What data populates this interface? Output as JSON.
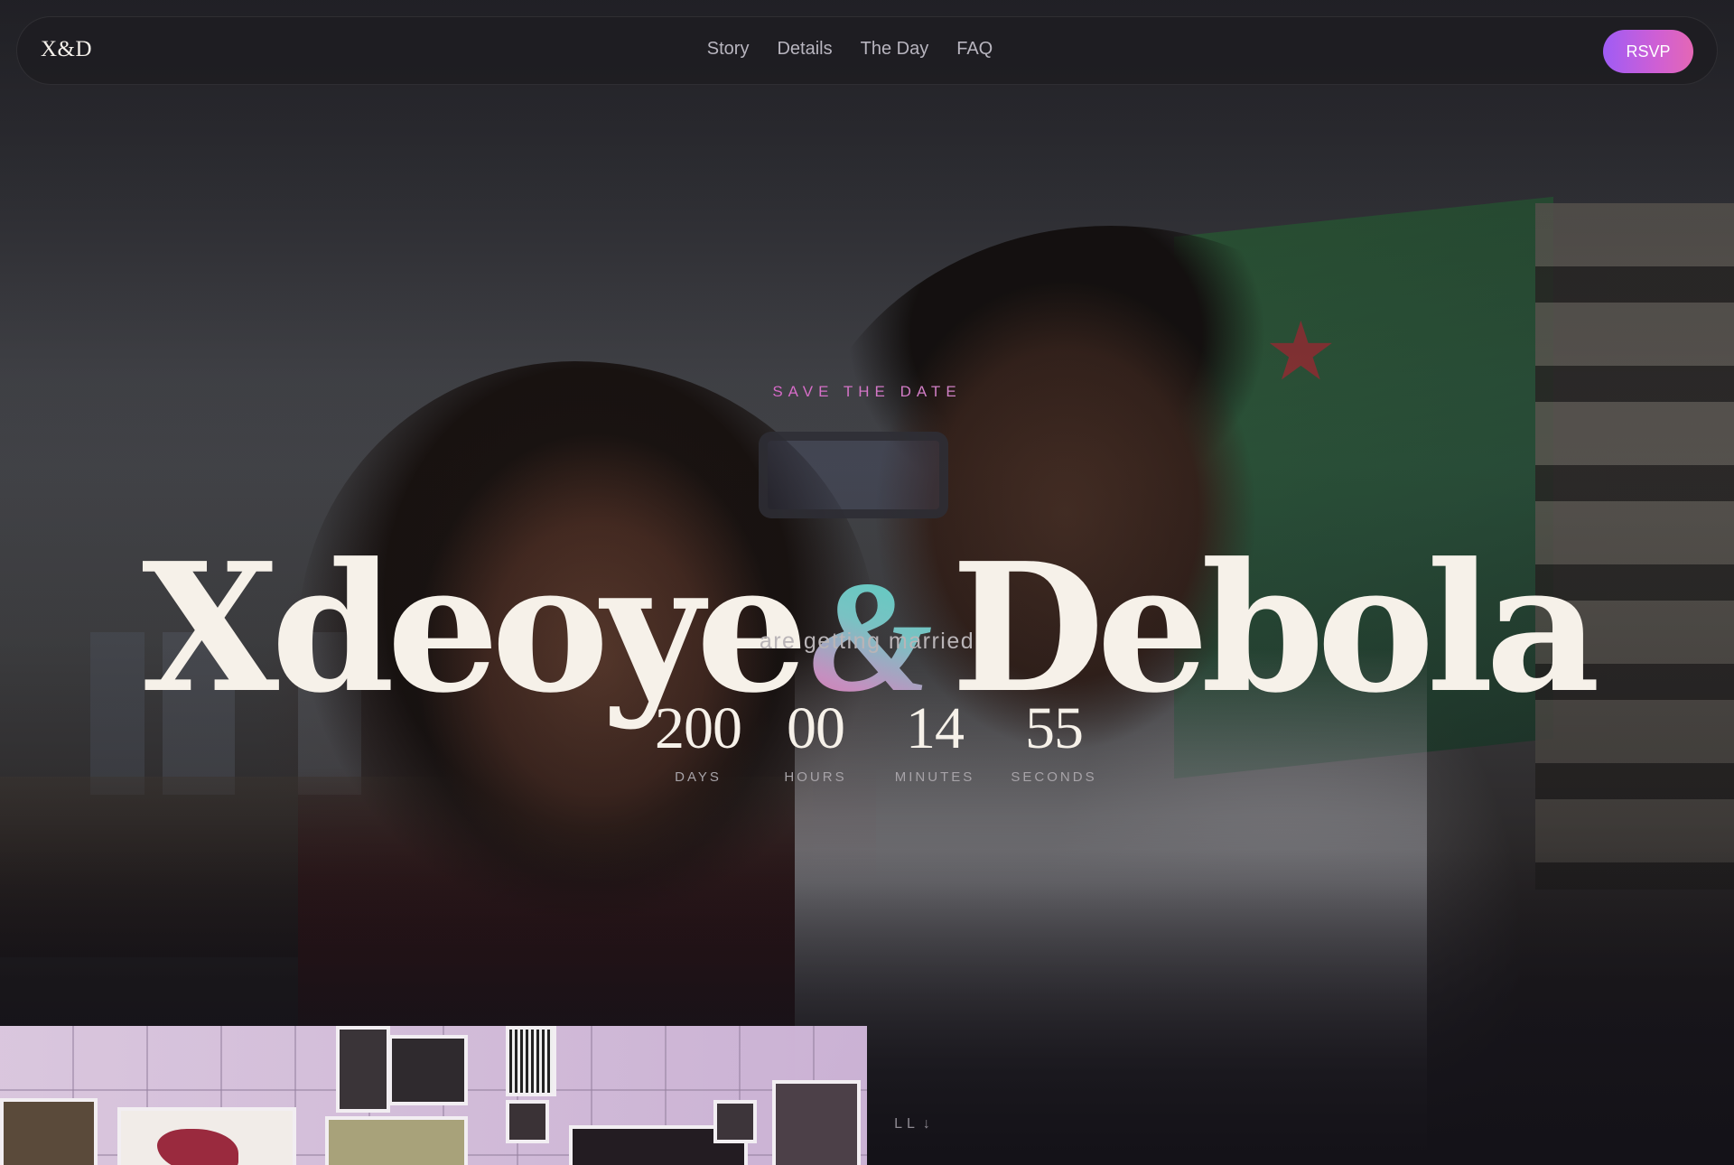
{
  "nav": {
    "logo": "X&D",
    "links": [
      {
        "label": "Story"
      },
      {
        "label": "Details"
      },
      {
        "label": "The Day"
      },
      {
        "label": "FAQ"
      }
    ],
    "rsvp_label": "RSVP"
  },
  "hero": {
    "eyebrow": "SAVE THE DATE",
    "name_left": "Xdeoye",
    "ampersand": "&",
    "name_right": "Debola",
    "subtitle": "are getting married",
    "countdown": [
      {
        "value": "200",
        "label": "DAYS"
      },
      {
        "value": "00",
        "label": "HOURS"
      },
      {
        "value": "14",
        "label": "MINUTES"
      },
      {
        "value": "55",
        "label": "SECONDS"
      }
    ],
    "scroll_hint": "LL",
    "scroll_icon": "arrow-down-icon"
  },
  "colors": {
    "accent_purple": "#9f5cf5",
    "accent_pink": "#e467b5",
    "accent_teal": "#52d1c1",
    "text_cream": "#f6f1e9"
  }
}
